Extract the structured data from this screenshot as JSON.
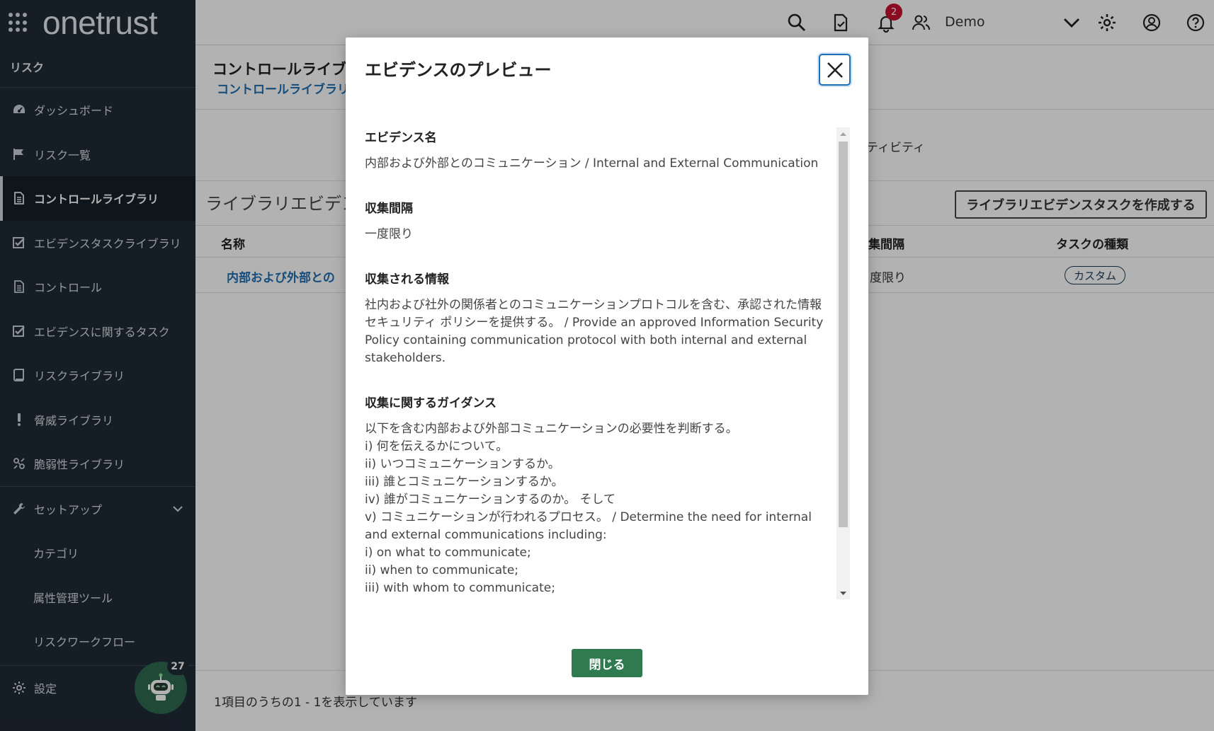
{
  "sidebar": {
    "logo": "onetrust",
    "section": "リスク",
    "items": [
      {
        "label": "ダッシュボード"
      },
      {
        "label": "リスク一覧"
      },
      {
        "label": "コントロールライブラリ"
      },
      {
        "label": "エビデンスタスクライブラリ"
      },
      {
        "label": "コントロール"
      },
      {
        "label": "エビデンスに関するタスク"
      },
      {
        "label": "リスクライブラリ"
      },
      {
        "label": "脅威ライブラリ"
      },
      {
        "label": "脆弱性ライブラリ"
      }
    ],
    "setup": {
      "label": "セットアップ",
      "children": [
        {
          "label": "カテゴリ"
        },
        {
          "label": "属性管理ツール"
        },
        {
          "label": "リスクワークフロー"
        }
      ]
    },
    "settings_label": "設定",
    "bot_badge": "27"
  },
  "header": {
    "notification_count": "2",
    "user_name": "Demo"
  },
  "main": {
    "page_title": "コントロールライブ",
    "breadcrumb": "コントロールライブラリ",
    "tab_activity": "ティビティ",
    "section_title": "ライブラリエビデン",
    "create_button": "ライブラリエビデンスタスクを作成する",
    "table": {
      "headers": {
        "name": "名称",
        "interval": "集間隔",
        "task_type": "タスクの種類"
      },
      "rows": [
        {
          "name": "内部および外部との",
          "interval": "度限り",
          "task_type": "カスタム"
        }
      ]
    },
    "pagination": "1項目のうちの1 - 1を表示しています"
  },
  "modal": {
    "title": "エビデンスのプレビュー",
    "fields": [
      {
        "label": "エビデンス名",
        "value": "内部および外部とのコミュニケーション / Internal and External Communication"
      },
      {
        "label": "収集間隔",
        "value": "一度限り"
      },
      {
        "label": "収集される情報",
        "value": "社内および社外の関係者とのコミュニケーションプロトコルを含む、承認された情報セキュリティ ポリシーを提供する。 / Provide an approved Information Security Policy containing communication protocol with both internal and external stakeholders."
      },
      {
        "label": "収集に関するガイダンス",
        "value": "以下を含む内部および外部コミュニケーションの必要性を判断する。\ni) 何を伝えるかについて。\nii) いつコミュニケーションするか。\niii) 誰とコミュニケーションするか。\niv) 誰がコミュニケーションするのか。 そして\nv) コミュニケーションが行われるプロセス。 / Determine the need for internal and external communications including:\ni) on what to communicate;\nii) when to communicate;\niii) with whom to communicate;"
      }
    ],
    "close_button": "閉じる"
  }
}
